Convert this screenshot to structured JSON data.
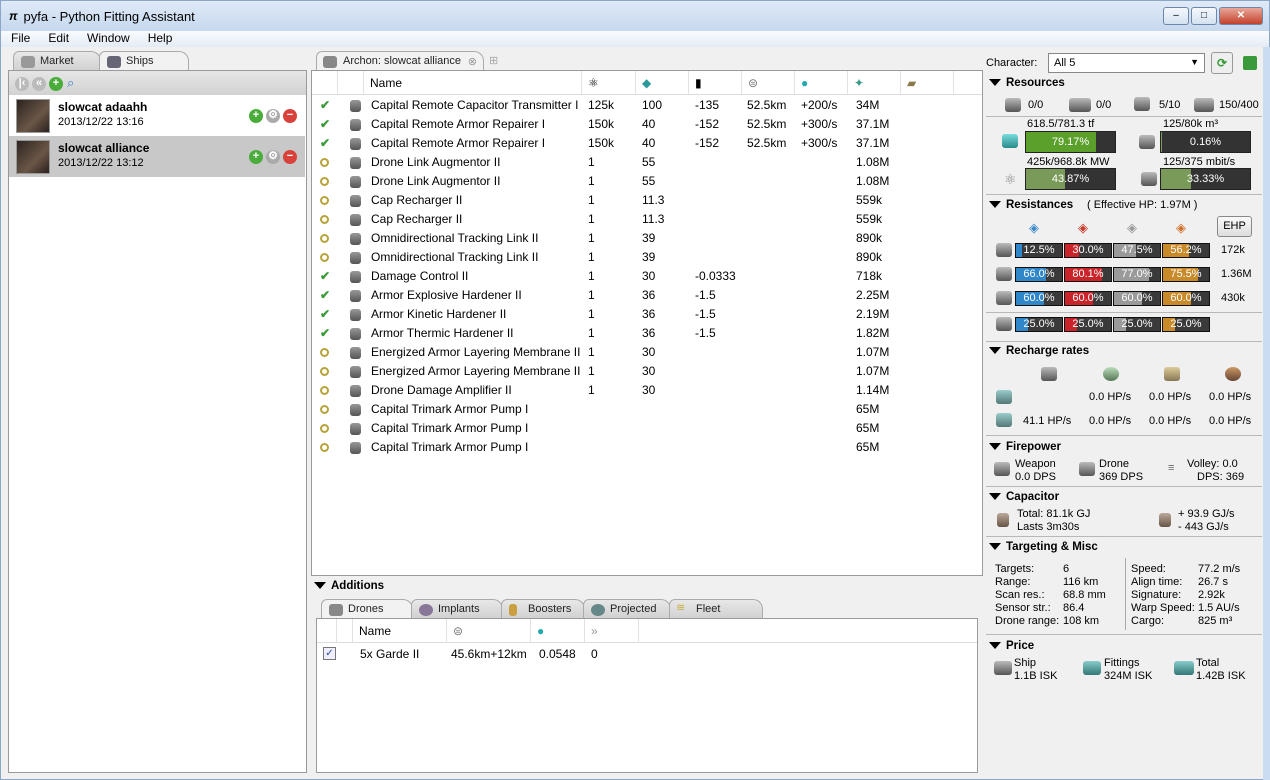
{
  "window": {
    "title": "pyfa - Python Fitting Assistant",
    "min": "–",
    "max": "□",
    "close": "✕"
  },
  "menu": [
    "File",
    "Edit",
    "Window",
    "Help"
  ],
  "left": {
    "tabs": [
      "Market",
      "Ships"
    ],
    "fits": [
      {
        "name": "slowcat adaahh",
        "date": "2013/12/22 13:16"
      },
      {
        "name": "slowcat alliance",
        "date": "2013/12/22 13:12"
      }
    ]
  },
  "fit_tab": {
    "label": "Archon: slowcat alliance"
  },
  "modules": {
    "header": {
      "name": "Name"
    },
    "rows": [
      {
        "state": "active",
        "name": "Capital Remote Capacitor Transmitter I",
        "cpu": "125k",
        "pg": "100",
        "cap": "-135",
        "range": "52.5km",
        "rate": "+200/s",
        "price": "34M"
      },
      {
        "state": "active",
        "name": "Capital Remote Armor Repairer I",
        "cpu": "150k",
        "pg": "40",
        "cap": "-152",
        "range": "52.5km",
        "rate": "+300/s",
        "price": "37.1M"
      },
      {
        "state": "active",
        "name": "Capital Remote Armor Repairer I",
        "cpu": "150k",
        "pg": "40",
        "cap": "-152",
        "range": "52.5km",
        "rate": "+300/s",
        "price": "37.1M"
      },
      {
        "state": "online",
        "name": "Drone Link Augmentor II",
        "cpu": "1",
        "pg": "55",
        "cap": "",
        "range": "",
        "rate": "",
        "price": "1.08M"
      },
      {
        "state": "online",
        "name": "Drone Link Augmentor II",
        "cpu": "1",
        "pg": "55",
        "cap": "",
        "range": "",
        "rate": "",
        "price": "1.08M"
      },
      {
        "state": "online",
        "name": "Cap Recharger II",
        "cpu": "1",
        "pg": "11.3",
        "cap": "",
        "range": "",
        "rate": "",
        "price": "559k"
      },
      {
        "state": "online",
        "name": "Cap Recharger II",
        "cpu": "1",
        "pg": "11.3",
        "cap": "",
        "range": "",
        "rate": "",
        "price": "559k"
      },
      {
        "state": "online",
        "name": "Omnidirectional Tracking Link II",
        "cpu": "1",
        "pg": "39",
        "cap": "",
        "range": "",
        "rate": "",
        "price": "890k"
      },
      {
        "state": "online",
        "name": "Omnidirectional Tracking Link II",
        "cpu": "1",
        "pg": "39",
        "cap": "",
        "range": "",
        "rate": "",
        "price": "890k"
      },
      {
        "state": "active",
        "name": "Damage Control II",
        "cpu": "1",
        "pg": "30",
        "cap": "-0.0333",
        "range": "",
        "rate": "",
        "price": "718k"
      },
      {
        "state": "active",
        "name": "Armor Explosive Hardener II",
        "cpu": "1",
        "pg": "36",
        "cap": "-1.5",
        "range": "",
        "rate": "",
        "price": "2.25M"
      },
      {
        "state": "active",
        "name": "Armor Kinetic Hardener II",
        "cpu": "1",
        "pg": "36",
        "cap": "-1.5",
        "range": "",
        "rate": "",
        "price": "2.19M"
      },
      {
        "state": "active",
        "name": "Armor Thermic Hardener II",
        "cpu": "1",
        "pg": "36",
        "cap": "-1.5",
        "range": "",
        "rate": "",
        "price": "1.82M"
      },
      {
        "state": "online",
        "name": "Energized Armor Layering Membrane II",
        "cpu": "1",
        "pg": "30",
        "cap": "",
        "range": "",
        "rate": "",
        "price": "1.07M"
      },
      {
        "state": "online",
        "name": "Energized Armor Layering Membrane II",
        "cpu": "1",
        "pg": "30",
        "cap": "",
        "range": "",
        "rate": "",
        "price": "1.07M"
      },
      {
        "state": "online",
        "name": "Drone Damage Amplifier II",
        "cpu": "1",
        "pg": "30",
        "cap": "",
        "range": "",
        "rate": "",
        "price": "1.14M"
      },
      {
        "state": "online",
        "name": "Capital Trimark Armor Pump I",
        "cpu": "",
        "pg": "",
        "cap": "",
        "range": "",
        "rate": "",
        "price": "65M"
      },
      {
        "state": "online",
        "name": "Capital Trimark Armor Pump I",
        "cpu": "",
        "pg": "",
        "cap": "",
        "range": "",
        "rate": "",
        "price": "65M"
      },
      {
        "state": "online",
        "name": "Capital Trimark Armor Pump I",
        "cpu": "",
        "pg": "",
        "cap": "",
        "range": "",
        "rate": "",
        "price": "65M"
      }
    ]
  },
  "additions": {
    "title": "Additions",
    "tabs": [
      "Drones",
      "Implants",
      "Boosters",
      "Projected",
      "Fleet"
    ],
    "header": {
      "name": "Name"
    },
    "drones": [
      {
        "checked": true,
        "check": "✓",
        "name": "5x Garde II",
        "range": "45.6km+12km",
        "tracking": "0.0548",
        "speed": "0"
      }
    ]
  },
  "character": {
    "label": "Character:",
    "value": "All 5"
  },
  "resources": {
    "title": "Resources",
    "hardpoints": [
      "0/0",
      "0/0",
      "5/10",
      "150/400"
    ],
    "cpu": {
      "label": "618.5/781.3 tf",
      "pct": "79.17%",
      "fill": 0.7917
    },
    "drone_bay": {
      "label": "125/80k m³",
      "pct": "0.16%",
      "fill": 0.0016
    },
    "pg": {
      "label": "425k/968.8k MW",
      "pct": "43.87%",
      "fill": 0.4387
    },
    "bandwidth": {
      "label": "125/375 mbit/s",
      "pct": "33.33%",
      "fill": 0.3333
    }
  },
  "resistances": {
    "title": "Resistances",
    "ehp": "( Effective HP: 1.97M )",
    "ehp_button": "EHP",
    "rows": [
      {
        "vals": [
          "12.5%",
          "30.0%",
          "47.5%",
          "56.2%"
        ],
        "fills": [
          0.125,
          0.3,
          0.475,
          0.562
        ],
        "hp": "172k"
      },
      {
        "vals": [
          "66.0%",
          "80.1%",
          "77.0%",
          "75.5%"
        ],
        "fills": [
          0.66,
          0.801,
          0.77,
          0.755
        ],
        "hp": "1.36M"
      },
      {
        "vals": [
          "60.0%",
          "60.0%",
          "60.0%",
          "60.0%"
        ],
        "fills": [
          0.6,
          0.6,
          0.6,
          0.6
        ],
        "hp": "430k"
      },
      {
        "vals": [
          "25.0%",
          "25.0%",
          "25.0%",
          "25.0%"
        ],
        "fills": [
          0.25,
          0.25,
          0.25,
          0.25
        ],
        "hp": ""
      }
    ],
    "colors": [
      "#2f86c8",
      "#c8242a",
      "#9a9a9a",
      "#c98a2a"
    ]
  },
  "recharge": {
    "title": "Recharge rates",
    "row1": [
      "0.0 HP/s",
      "0.0 HP/s",
      "0.0 HP/s"
    ],
    "row2": [
      "41.1 HP/s",
      "0.0 HP/s",
      "0.0 HP/s",
      "0.0 HP/s"
    ]
  },
  "firepower": {
    "title": "Firepower",
    "weapon": "Weapon",
    "weapon_dps": "0.0 DPS",
    "drone": "Drone",
    "drone_dps": "369 DPS",
    "volley": "Volley: 0.0",
    "dps": "DPS: 369"
  },
  "capacitor": {
    "title": "Capacitor",
    "total": "Total: 81.1k GJ",
    "lasts": "Lasts 3m30s",
    "plus": "+ 93.9 GJ/s",
    "minus": "-  443 GJ/s"
  },
  "targeting": {
    "title": "Targeting & Misc",
    "left": [
      [
        "Targets:",
        "6"
      ],
      [
        "Range:",
        "116 km"
      ],
      [
        "Scan res.:",
        "68.8 mm"
      ],
      [
        "Sensor str.:",
        "86.4"
      ],
      [
        "Drone range:",
        "108 km"
      ]
    ],
    "right": [
      [
        "Speed:",
        "77.2 m/s"
      ],
      [
        "Align time:",
        "26.7 s"
      ],
      [
        "Signature:",
        "2.92k"
      ],
      [
        "Warp Speed:",
        "1.5 AU/s"
      ],
      [
        "Cargo:",
        "825 m³"
      ]
    ]
  },
  "price": {
    "title": "Price",
    "ship": "Ship",
    "ship_val": "1.1B ISK",
    "fittings": "Fittings",
    "fittings_val": "324M ISK",
    "total": "Total",
    "total_val": "1.42B ISK"
  }
}
